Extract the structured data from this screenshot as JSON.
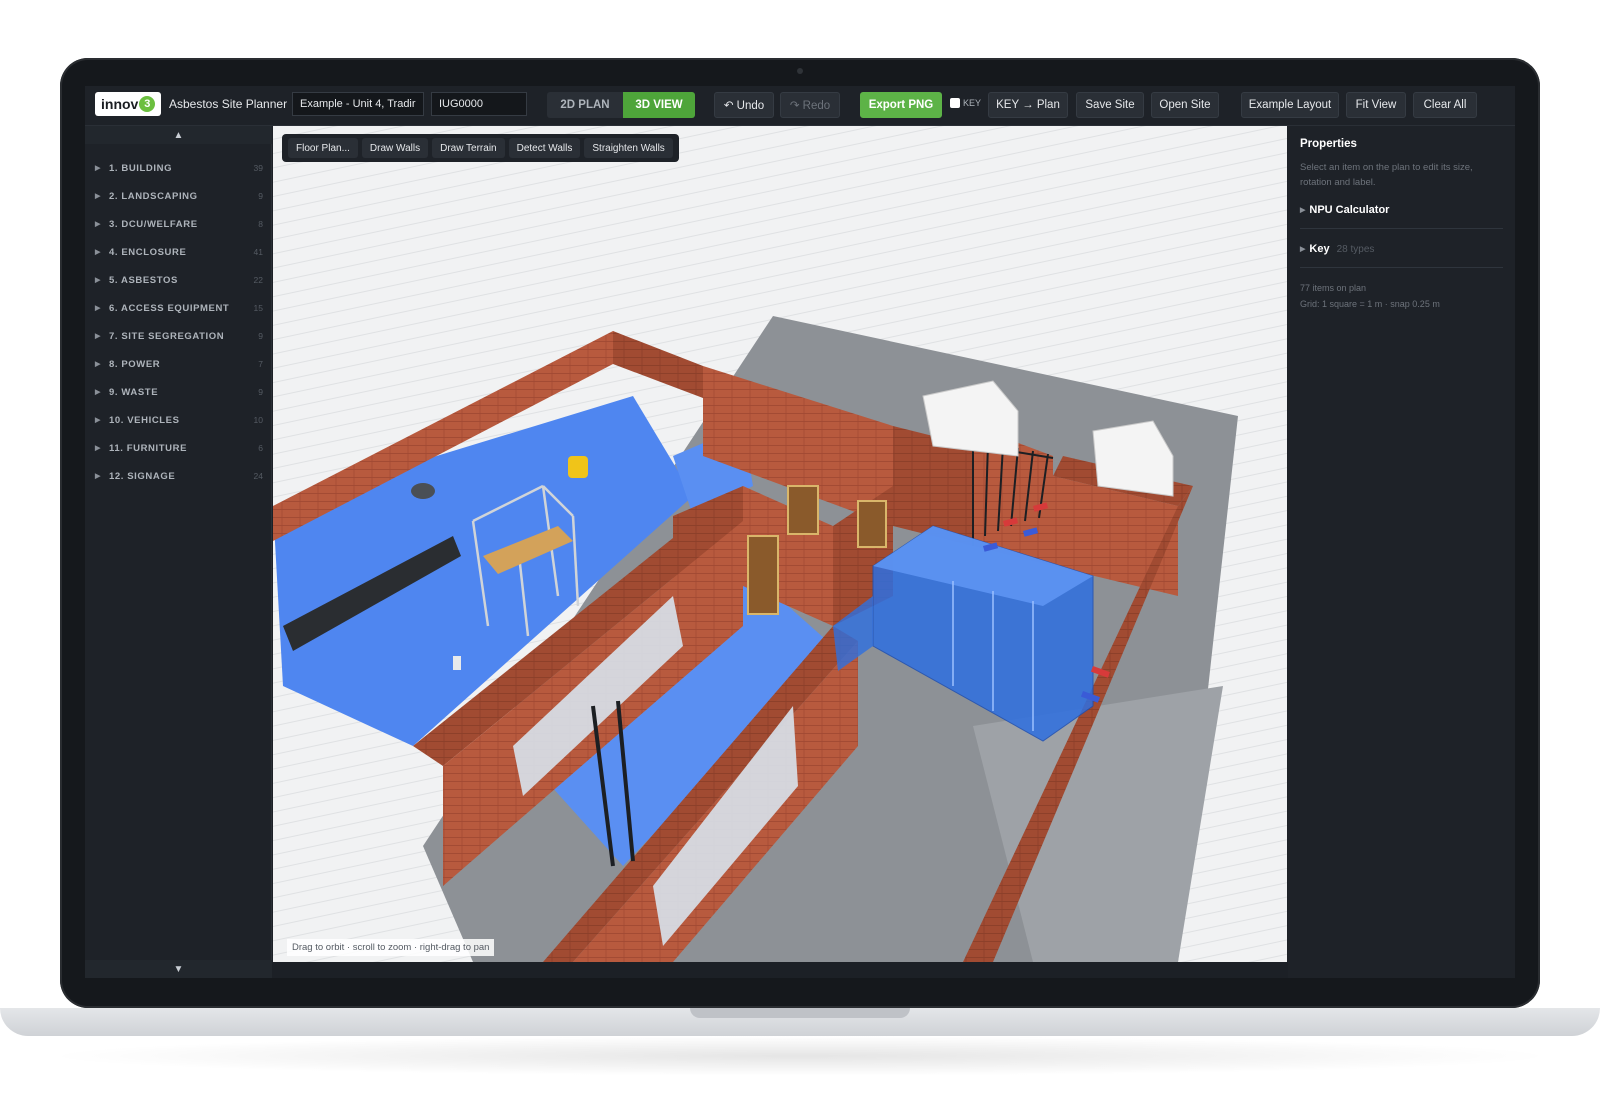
{
  "app": {
    "logo_text": "innov",
    "logo_badge": "3",
    "title": "Asbestos Site Planner",
    "site_name_value": "Example - Unit 4, Tradir",
    "site_code_value": "IUG0000"
  },
  "toolbar": {
    "plan_2d": "2D PLAN",
    "view_3d": "3D VIEW",
    "undo": "↶ Undo",
    "redo": "↷ Redo",
    "export_png": "Export PNG",
    "key_checkbox_label": "KEY",
    "key_to_plan": "KEY → Plan",
    "save_site": "Save Site",
    "open_site": "Open Site",
    "example_layout": "Example Layout",
    "fit_view": "Fit View",
    "clear_all": "Clear All"
  },
  "sidebar": {
    "scroll_up": "▲",
    "scroll_down": "▼",
    "categories": [
      {
        "label": "1. BUILDING",
        "count": "39"
      },
      {
        "label": "2. LANDSCAPING",
        "count": "9"
      },
      {
        "label": "3. DCU/WELFARE",
        "count": "8"
      },
      {
        "label": "4. ENCLOSURE",
        "count": "41"
      },
      {
        "label": "5. ASBESTOS",
        "count": "22"
      },
      {
        "label": "6. ACCESS EQUIPMENT",
        "count": "15"
      },
      {
        "label": "7. SITE SEGREGATION",
        "count": "9"
      },
      {
        "label": "8. POWER",
        "count": "7"
      },
      {
        "label": "9. WASTE",
        "count": "9"
      },
      {
        "label": "10. VEHICLES",
        "count": "10"
      },
      {
        "label": "11. FURNITURE",
        "count": "6"
      },
      {
        "label": "12. SIGNAGE",
        "count": "24"
      }
    ]
  },
  "viewport": {
    "tools": [
      "Floor Plan...",
      "Draw Walls",
      "Draw Terrain",
      "Detect Walls",
      "Straighten Walls"
    ],
    "hint": "Drag to orbit · scroll to zoom · right-drag to pan"
  },
  "properties": {
    "title": "Properties",
    "help": "Select an item on the plan to edit its size, rotation and label.",
    "npu_calculator": "NPU Calculator",
    "key_label": "Key",
    "key_types": "28 types",
    "items_on_plan": "77 items on plan",
    "grid_info": "Grid: 1 square = 1 m · snap 0.25 m"
  },
  "colors": {
    "accent_green": "#4ea53a",
    "brick": "#b4553a",
    "floor_blue": "#4f86f0",
    "concrete": "#8a8e94"
  }
}
